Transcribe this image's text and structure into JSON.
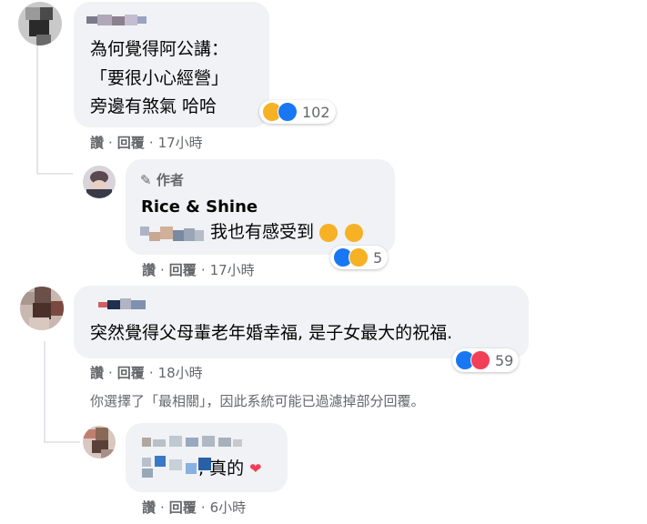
{
  "comments": [
    {
      "lines": [
        "為何覺得阿公講：",
        "「要很小心經營」",
        "旁邊有煞氣 哈哈"
      ],
      "reaction_count": "102",
      "reactions": [
        "haha",
        "like"
      ],
      "actions": {
        "like": "讚",
        "reply": "回覆",
        "time": "17小時"
      }
    },
    {
      "author_badge": "作者",
      "name": "Rice & Shine",
      "text": "我也有感受到",
      "reaction_count": "5",
      "reactions": [
        "like",
        "haha"
      ],
      "actions": {
        "like": "讚",
        "reply": "回覆",
        "time": "17小時"
      }
    },
    {
      "text": "突然覺得父母輩老年婚幸福, 是子女最大的祝福.",
      "reaction_count": "59",
      "reactions": [
        "like",
        "love"
      ],
      "actions": {
        "like": "讚",
        "reply": "回覆",
        "time": "18小時"
      }
    },
    {
      "text": ", 真的",
      "actions": {
        "like": "讚",
        "reply": "回覆",
        "time": "6小時"
      }
    }
  ],
  "filter_note": "你選擇了「最相關」，因此系統可能已過濾掉部分回覆。",
  "separator": "·",
  "colors": {
    "bubble": "#f0f2f5",
    "secondary_text": "#65676b",
    "like": "#1877f2",
    "haha": "#f7b125",
    "love": "#f33e58"
  }
}
